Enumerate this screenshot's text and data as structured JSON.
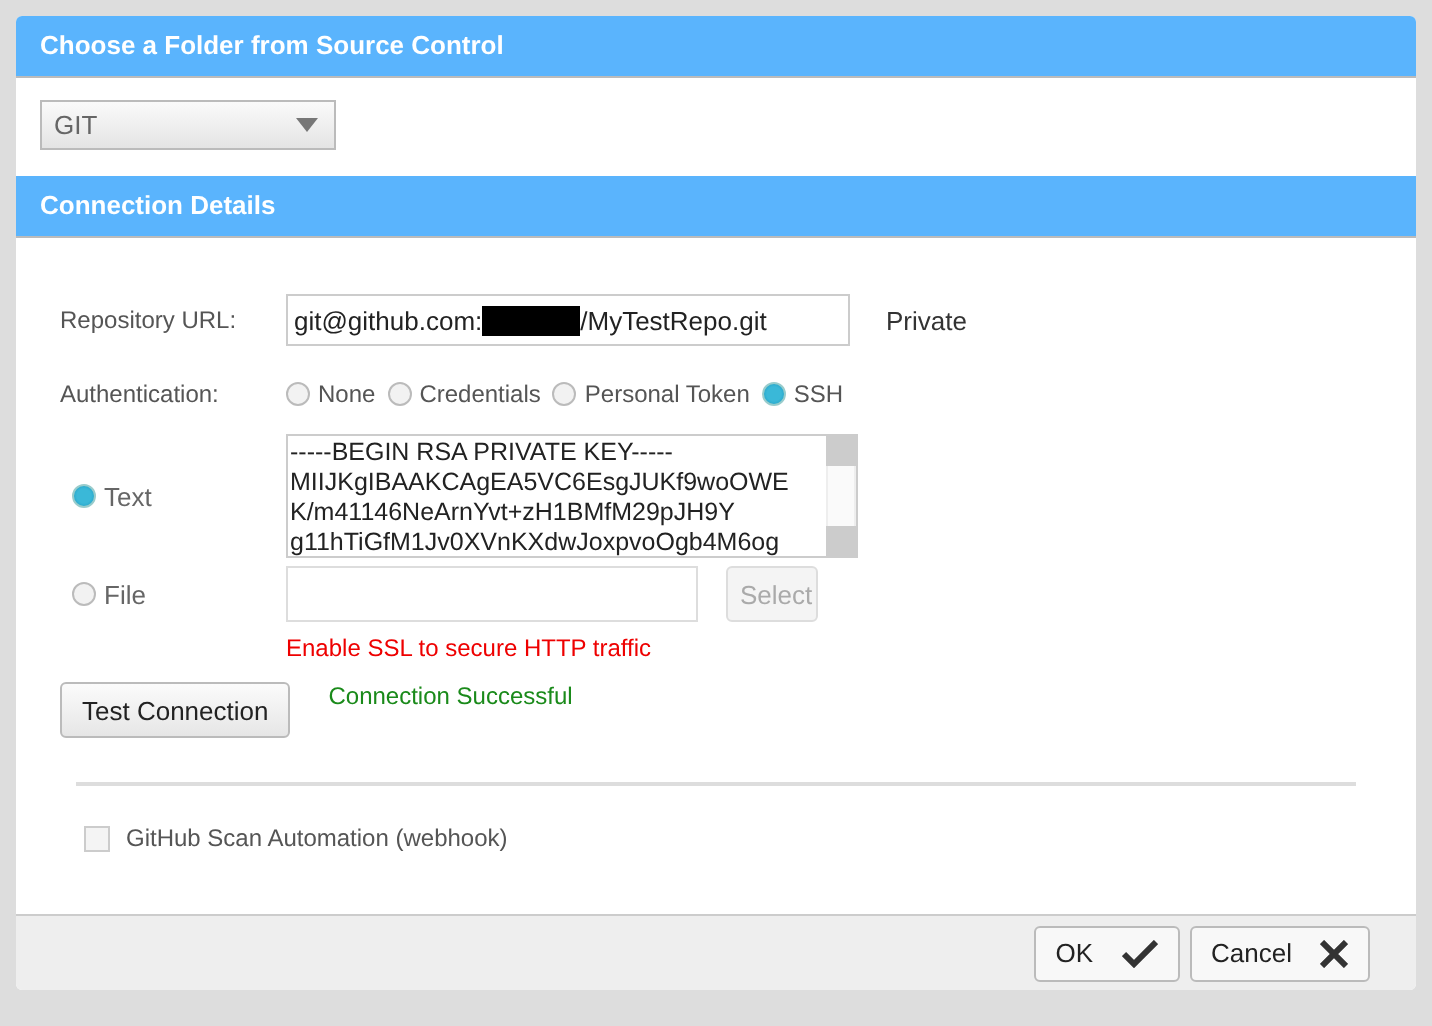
{
  "sections": [
    {
      "title": "Choose a Folder from Source Control"
    },
    {
      "title": "Connection Details"
    }
  ],
  "source_select": {
    "value": "GIT"
  },
  "repository": {
    "label": "Repository URL:",
    "value_prefix": "git@github.com:",
    "value_suffix": "/MyTestRepo.git",
    "visibility": "Private"
  },
  "authentication": {
    "label": "Authentication:",
    "options": [
      {
        "label": "None",
        "selected": false
      },
      {
        "label": "Credentials",
        "selected": false
      },
      {
        "label": "Personal Token",
        "selected": false
      },
      {
        "label": "SSH",
        "selected": true
      }
    ]
  },
  "key_source": [
    {
      "kind": "text",
      "label": "Text",
      "selected": true,
      "lines": [
        "-----BEGIN RSA PRIVATE KEY-----",
        "MIIJKgIBAAKCAgEA5VC6EsgJUKf9woOWE",
        "K/m41146NeArnYvt+zH1BMfM29pJH9Y",
        "g11hTiGfM1Jv0XVnKXdwJoxpvoOgb4M6og"
      ]
    },
    {
      "kind": "file",
      "label": "File",
      "selected": false,
      "button": "Select"
    }
  ],
  "ssl_warning": "Enable SSL to secure HTTP traffic",
  "test_button": "Test Connection",
  "test_result": "Connection Successful",
  "webhook": {
    "label": "GitHub Scan Automation (webhook)",
    "checked": false
  },
  "buttons": [
    {
      "label": "OK",
      "kind": "ok"
    },
    {
      "label": "Cancel",
      "kind": "cancel"
    }
  ]
}
